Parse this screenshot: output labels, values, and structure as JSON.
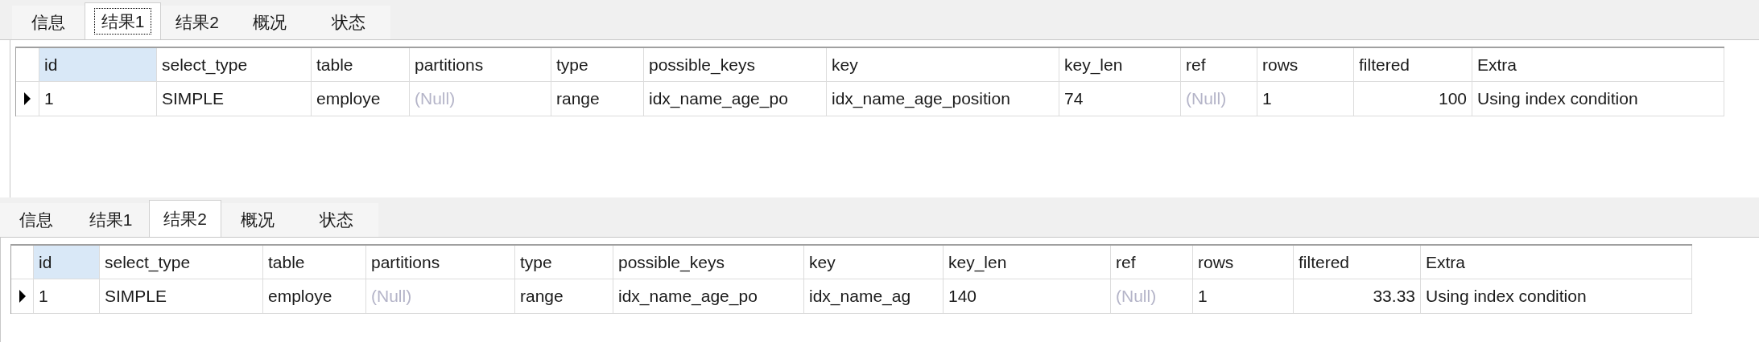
{
  "panels": [
    {
      "tabs": [
        {
          "label": "信息",
          "selected": false,
          "focused": false
        },
        {
          "label": "结果1",
          "selected": true,
          "focused": true
        },
        {
          "label": "结果2",
          "selected": false,
          "focused": false
        },
        {
          "label": "概况",
          "selected": false,
          "focused": false
        },
        {
          "label": "状态",
          "selected": false,
          "focused": false
        }
      ],
      "table": {
        "columns": [
          {
            "label": "id",
            "selected": true
          },
          {
            "label": "select_type",
            "selected": false
          },
          {
            "label": "table",
            "selected": false
          },
          {
            "label": "partitions",
            "selected": false
          },
          {
            "label": "type",
            "selected": false
          },
          {
            "label": "possible_keys",
            "selected": false
          },
          {
            "label": "key",
            "selected": false
          },
          {
            "label": "key_len",
            "selected": false
          },
          {
            "label": "ref",
            "selected": false
          },
          {
            "label": "rows",
            "selected": false
          },
          {
            "label": "filtered",
            "selected": false
          },
          {
            "label": "Extra",
            "selected": false
          }
        ],
        "rows": [
          {
            "current": true,
            "cells": [
              {
                "kind": "text",
                "text": "1"
              },
              {
                "kind": "text",
                "text": "SIMPLE"
              },
              {
                "kind": "text",
                "text": "employe"
              },
              {
                "kind": "null",
                "text": "(Null)"
              },
              {
                "kind": "text",
                "text": "range"
              },
              {
                "kind": "text",
                "text": "idx_name_age_po"
              },
              {
                "kind": "text",
                "text": "idx_name_age_position"
              },
              {
                "kind": "text",
                "text": "74"
              },
              {
                "kind": "null",
                "text": "(Null)"
              },
              {
                "kind": "text",
                "text": "1"
              },
              {
                "kind": "number",
                "text": "100"
              },
              {
                "kind": "text",
                "text": "Using index condition"
              }
            ]
          }
        ]
      }
    },
    {
      "tabs": [
        {
          "label": "信息",
          "selected": false,
          "focused": false
        },
        {
          "label": "结果1",
          "selected": false,
          "focused": false
        },
        {
          "label": "结果2",
          "selected": true,
          "focused": false
        },
        {
          "label": "概况",
          "selected": false,
          "focused": false
        },
        {
          "label": "状态",
          "selected": false,
          "focused": false
        }
      ],
      "table": {
        "columns": [
          {
            "label": "id",
            "selected": true
          },
          {
            "label": "select_type",
            "selected": false
          },
          {
            "label": "table",
            "selected": false
          },
          {
            "label": "partitions",
            "selected": false
          },
          {
            "label": "type",
            "selected": false
          },
          {
            "label": "possible_keys",
            "selected": false
          },
          {
            "label": "key",
            "selected": false
          },
          {
            "label": "key_len",
            "selected": false
          },
          {
            "label": "ref",
            "selected": false
          },
          {
            "label": "rows",
            "selected": false
          },
          {
            "label": "filtered",
            "selected": false
          },
          {
            "label": "Extra",
            "selected": false
          }
        ],
        "rows": [
          {
            "current": true,
            "cells": [
              {
                "kind": "text",
                "text": "1"
              },
              {
                "kind": "text",
                "text": "SIMPLE"
              },
              {
                "kind": "text",
                "text": "employe"
              },
              {
                "kind": "null",
                "text": "(Null)"
              },
              {
                "kind": "text",
                "text": "range"
              },
              {
                "kind": "text",
                "text": "idx_name_age_po"
              },
              {
                "kind": "text",
                "text": "idx_name_ag"
              },
              {
                "kind": "text",
                "text": "140"
              },
              {
                "kind": "null",
                "text": "(Null)"
              },
              {
                "kind": "text",
                "text": "1"
              },
              {
                "kind": "number",
                "text": "33.33"
              },
              {
                "kind": "text",
                "text": "Using index condition"
              }
            ]
          }
        ]
      }
    }
  ]
}
